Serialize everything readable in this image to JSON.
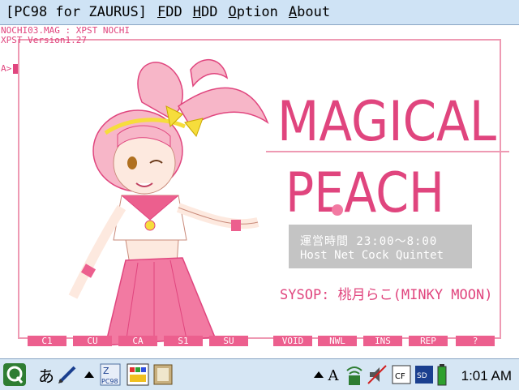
{
  "menubar": {
    "app_title": "[PC98 for ZAURUS]",
    "items": [
      {
        "label": "FDD",
        "underline": "F",
        "rest": "DD"
      },
      {
        "label": "HDD",
        "underline": "H",
        "rest": "DD"
      },
      {
        "label": "Option",
        "underline": "O",
        "rest": "ption"
      },
      {
        "label": "About",
        "underline": "A",
        "rest": "bout"
      }
    ]
  },
  "terminal": {
    "line1": "NOCHI03.MAG : XPST NOCHI",
    "line2": "XPST Version1.27",
    "prompt": "A>"
  },
  "artwork": {
    "title_line1": "MAGICAL",
    "title_line2": "PEACH",
    "info_line1": "運営時間  23:00〜8:00",
    "info_line2": "Host  Net Cock Quintet",
    "sysop": "SYSOP: 桃月らこ(MINKY MOON)",
    "accent_color": "#e0457e",
    "frame_color": "#ee9ab3"
  },
  "function_keys": [
    "C1",
    "CU",
    "CA",
    "S1",
    "SU",
    "VOID",
    "NWL",
    "INS",
    "REP",
    "?"
  ],
  "taskbar": {
    "start_icon": "qtopia-q-icon",
    "input_method": "あ",
    "clock": "1:01 AM"
  }
}
